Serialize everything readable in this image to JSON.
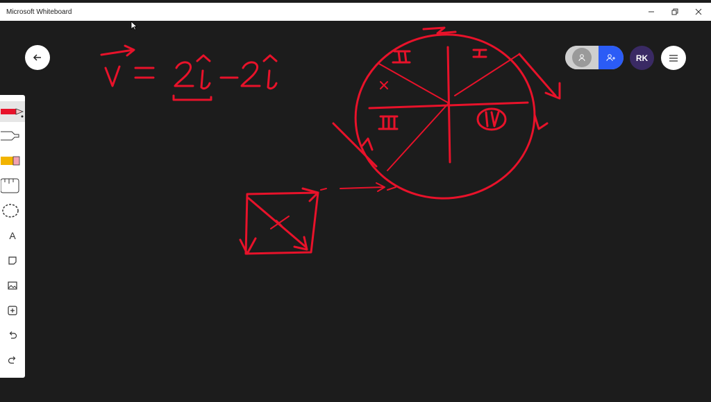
{
  "window": {
    "title": "Microsoft Whiteboard",
    "controls": {
      "minimize": "minimize-icon",
      "restore": "restore-icon",
      "close": "close-icon"
    }
  },
  "header": {
    "back_icon": "arrow-left-icon",
    "collaborators": [
      "person-icon",
      "person-add-icon"
    ],
    "avatar_initials": "RK",
    "menu_icon": "hamburger-icon"
  },
  "toolbar": {
    "tools": [
      {
        "name": "red-pen",
        "icon": "pen-icon",
        "active": true
      },
      {
        "name": "highlighter",
        "icon": "highlighter-icon"
      },
      {
        "name": "eraser",
        "icon": "eraser-icon"
      },
      {
        "name": "ruler",
        "icon": "ruler-icon"
      },
      {
        "name": "lasso",
        "icon": "lasso-icon"
      },
      {
        "name": "text",
        "icon": "text-icon",
        "label": "A"
      },
      {
        "name": "note",
        "icon": "note-icon"
      },
      {
        "name": "image",
        "icon": "image-icon"
      },
      {
        "name": "insert",
        "icon": "plus-icon"
      },
      {
        "name": "undo",
        "icon": "undo-icon"
      },
      {
        "name": "redo",
        "icon": "redo-icon"
      }
    ]
  },
  "colors": {
    "ink": "#e8122a",
    "board": "#1c1c1c",
    "accent": "#2b5cf6",
    "avatar_bg": "#3a2a64"
  }
}
